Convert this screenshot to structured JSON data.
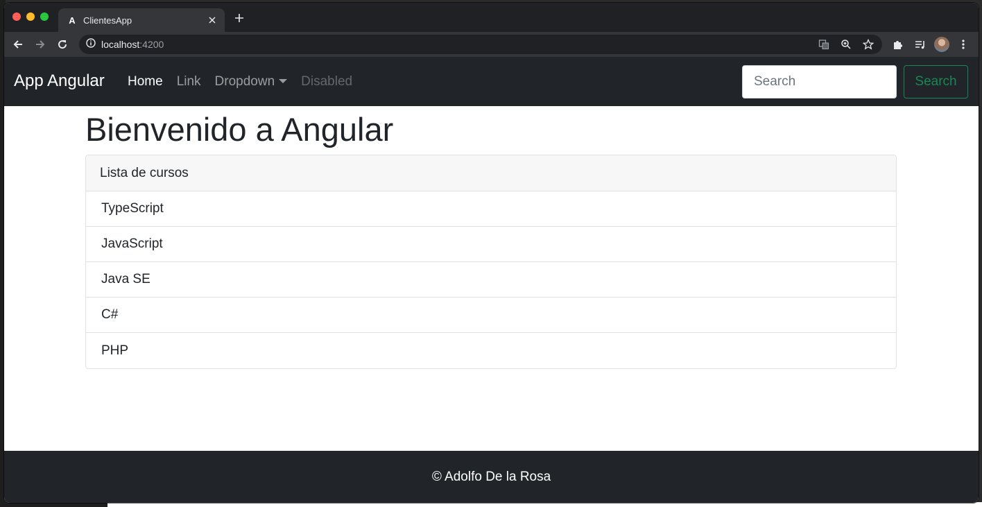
{
  "browser": {
    "tab_title": "ClientesApp",
    "tab_favicon": "A",
    "url_host": "localhost",
    "url_port": ":4200"
  },
  "navbar": {
    "brand": "App Angular",
    "links": [
      {
        "label": "Home",
        "state": "active"
      },
      {
        "label": "Link",
        "state": "normal"
      },
      {
        "label": "Dropdown",
        "state": "dropdown"
      },
      {
        "label": "Disabled",
        "state": "disabled"
      }
    ],
    "search_placeholder": "Search",
    "search_button": "Search"
  },
  "main": {
    "title": "Bienvenido a Angular",
    "card_header": "Lista de cursos",
    "courses": [
      "TypeScript",
      "JavaScript",
      "Java SE",
      "C#",
      "PHP"
    ]
  },
  "footer": {
    "text": "© Adolfo De la Rosa"
  },
  "colors": {
    "navbar_bg": "#212529",
    "success": "#198754"
  }
}
